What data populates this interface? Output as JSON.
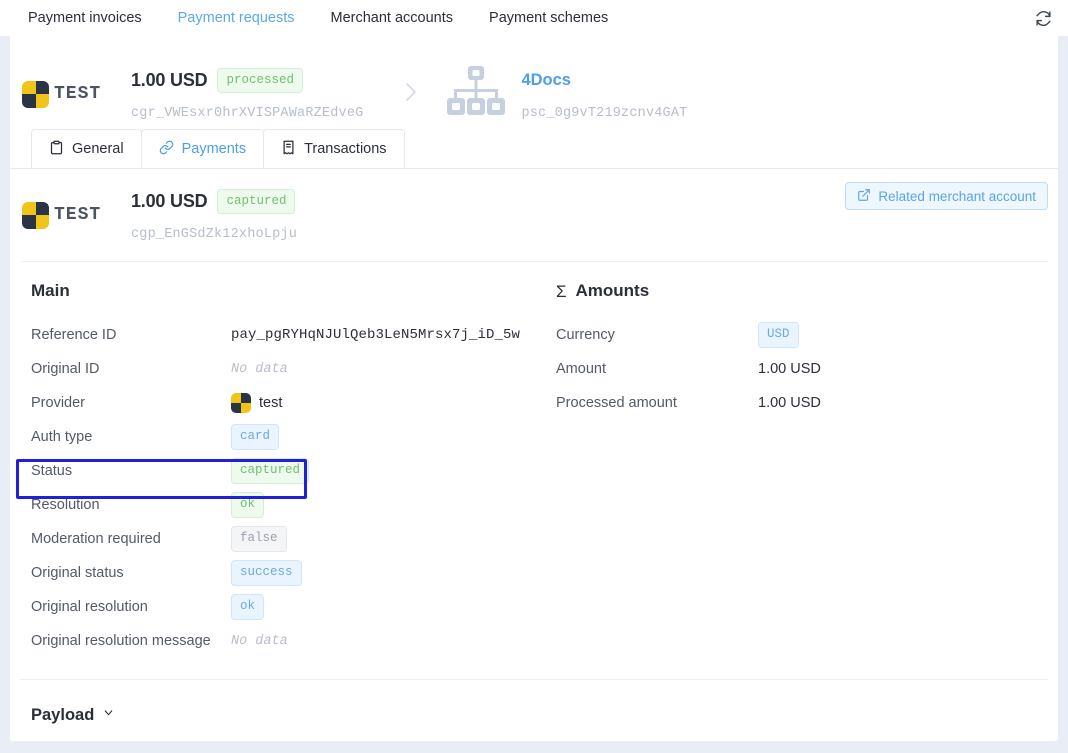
{
  "topbar": {
    "tabs": [
      {
        "label": "Payment invoices",
        "active": false
      },
      {
        "label": "Payment requests",
        "active": true
      },
      {
        "label": "Merchant accounts",
        "active": false
      },
      {
        "label": "Payment schemes",
        "active": false
      }
    ],
    "refresh_icon": "refresh-icon"
  },
  "request_header": {
    "logo_text": "TEST",
    "amount": "1.00 USD",
    "status_badge": "processed",
    "id": "cgr_VWEsxr0hrXVISPAWaRZEdveG",
    "separator_icon": "chevron-right-icon",
    "scheme_icon": "sitemap-icon",
    "scheme_name": "4Docs",
    "scheme_id": "psc_0g9vT219zcnv4GAT"
  },
  "inner_tabs": [
    {
      "label": "General",
      "icon": "clipboard-icon",
      "active": false
    },
    {
      "label": "Payments",
      "icon": "link-icon",
      "active": true
    },
    {
      "label": "Transactions",
      "icon": "receipt-icon",
      "active": false
    }
  ],
  "payment_header": {
    "logo_text": "TEST",
    "amount": "1.00 USD",
    "status_badge": "captured",
    "id": "cgp_EnGSdZk12xhoLpju",
    "related_button": {
      "label": "Related merchant account",
      "icon": "external-link-icon"
    }
  },
  "main_section": {
    "title": "Main",
    "fields": [
      {
        "label": "Reference ID",
        "value": "pay_pgRYHqNJUlQeb3LeN5Mrsx7j_iD_5w",
        "kind": "mono"
      },
      {
        "label": "Original ID",
        "value": "No data",
        "kind": "nodata"
      },
      {
        "label": "Provider",
        "value": "test",
        "kind": "provider"
      },
      {
        "label": "Auth type",
        "value": "card",
        "kind": "badge-blue",
        "highlighted": true
      },
      {
        "label": "Status",
        "value": "captured",
        "kind": "badge-green"
      },
      {
        "label": "Resolution",
        "value": "ok",
        "kind": "badge-green"
      },
      {
        "label": "Moderation required",
        "value": "false",
        "kind": "badge-gray"
      },
      {
        "label": "Original status",
        "value": "success",
        "kind": "badge-blue"
      },
      {
        "label": "Original resolution",
        "value": "ok",
        "kind": "badge-blue"
      },
      {
        "label": "Original resolution message",
        "value": "No data",
        "kind": "nodata"
      }
    ]
  },
  "amounts_section": {
    "title": "Amounts",
    "icon": "sigma-icon",
    "fields": [
      {
        "label": "Currency",
        "value": "USD",
        "kind": "badge-blue"
      },
      {
        "label": "Amount",
        "value": "1.00 USD",
        "kind": "text"
      },
      {
        "label": "Processed amount",
        "value": "1.00 USD",
        "kind": "text"
      }
    ]
  },
  "payload": {
    "title": "Payload",
    "chevron_icon": "chevron-down-icon"
  },
  "colors": {
    "page_background": "#e9edf5",
    "accent_blue": "#4c9fe8",
    "badge_green_text": "#6fc06f",
    "badge_blue_text": "#6aa9e4",
    "highlight_border": "#1f1fdd",
    "brand_yellow": "#f0c419",
    "brand_dark": "#2b3444"
  }
}
